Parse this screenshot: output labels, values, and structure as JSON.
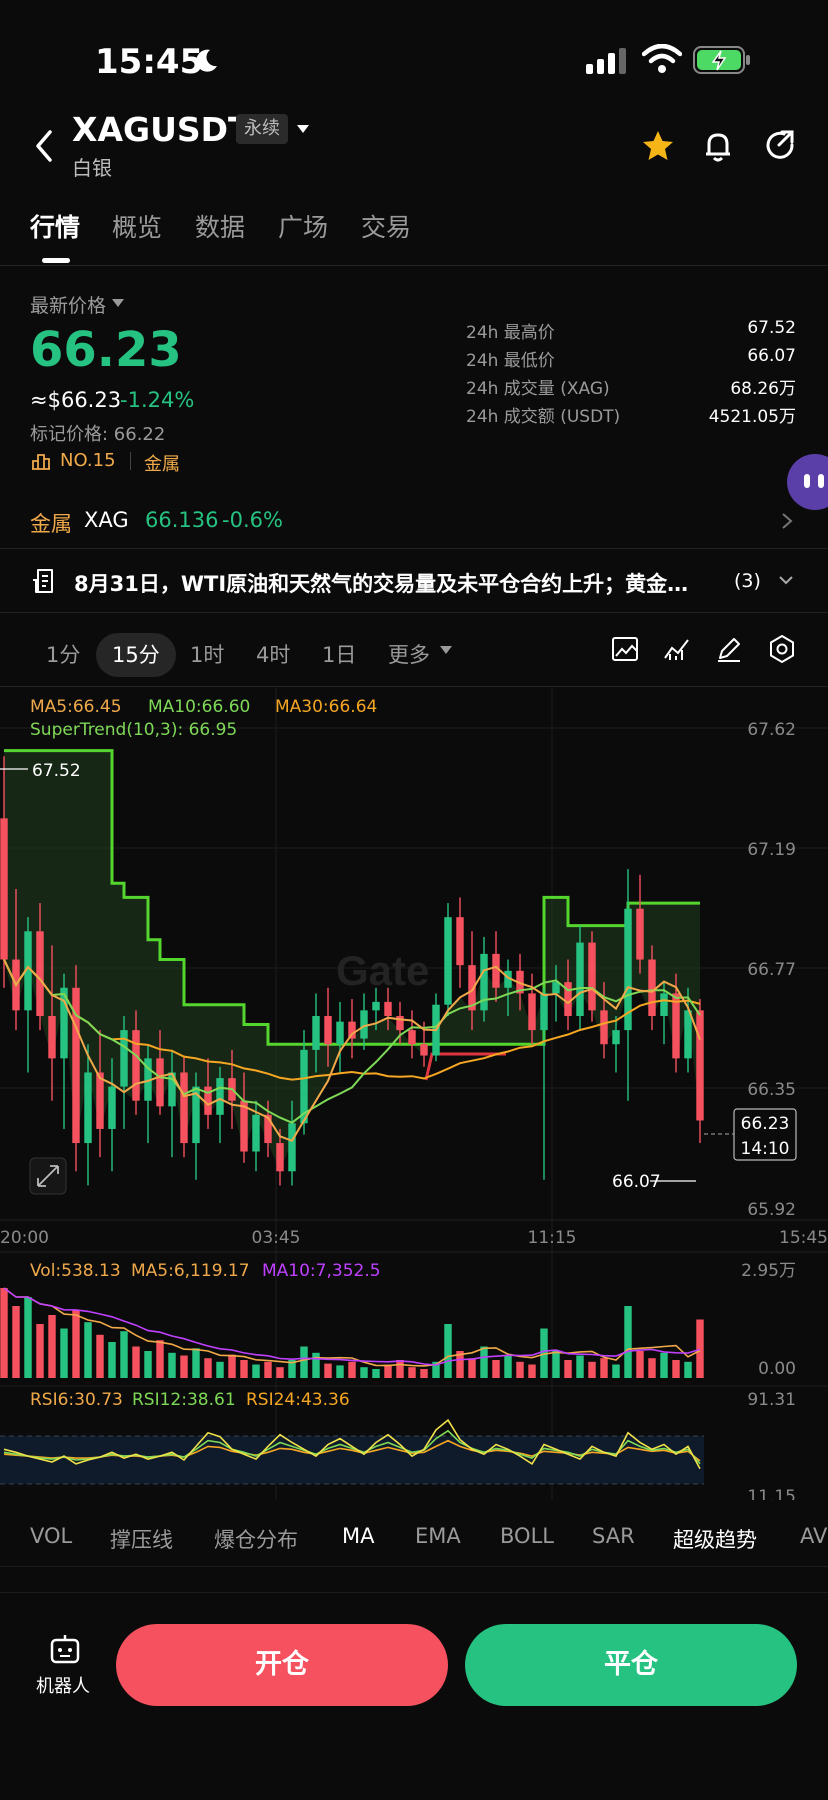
{
  "status_bar": {
    "time": "15:45"
  },
  "header": {
    "pair": "XAGUSDT",
    "contract_type": "永续",
    "subtitle": "白银"
  },
  "tabs": [
    {
      "label": "行情",
      "active": true
    },
    {
      "label": "概览"
    },
    {
      "label": "数据"
    },
    {
      "label": "广场"
    },
    {
      "label": "交易"
    }
  ],
  "price": {
    "label": "最新价格",
    "last": "66.23",
    "usd": "≈$66.23",
    "change": "-1.24%",
    "mark": "标记价格: 66.22",
    "rank": "NO.15",
    "category": "金属"
  },
  "stats": [
    {
      "label": "24h 最高价",
      "value": "67.52"
    },
    {
      "label": "24h 最低价",
      "value": "66.07"
    },
    {
      "label": "24h 成交量 (XAG)",
      "value": "68.26万"
    },
    {
      "label": "24h 成交额 (USDT)",
      "value": "4521.05万"
    }
  ],
  "metal": {
    "label": "金属",
    "code": "XAG",
    "price": "66.136",
    "change": "-0.6%"
  },
  "news": {
    "text": "8月31日，WTI原油和天然气的交易量及未平仓合约上升；黄金…",
    "count": "(3)"
  },
  "intervals": [
    {
      "label": "1分"
    },
    {
      "label": "15分",
      "active": true
    },
    {
      "label": "1时"
    },
    {
      "label": "4时"
    },
    {
      "label": "1日"
    },
    {
      "label": "更多"
    }
  ],
  "chart_legend": {
    "ma5": "MA5:66.45",
    "ma10": "MA10:66.60",
    "ma30": "MA30:66.64",
    "supertrend": "SuperTrend(10,3): 66.95",
    "high_marker": "67.52",
    "low_marker": "66.07",
    "current_price": "66.23",
    "countdown": "14:10"
  },
  "vol_legend": {
    "vol": "Vol:538.13",
    "ma5": "MA5:6,119.17",
    "ma10": "MA10:7,352.5"
  },
  "rsi_legend": {
    "rsi6": "RSI6:30.73",
    "rsi12": "RSI12:38.61",
    "rsi24": "RSI24:43.36"
  },
  "indicators": [
    "VOL",
    "撑压线",
    "爆仓分布",
    "MA",
    "EMA",
    "BOLL",
    "SAR",
    "超级趋势",
    "AV"
  ],
  "actions": {
    "robot": "机器人",
    "open": "开仓",
    "close": "平仓"
  },
  "colors": {
    "up": "#26c281",
    "down": "#f5515f",
    "ma5": "#f0a94a",
    "ma10": "#7ed957",
    "ma30": "#f5a623",
    "vol_ma10": "#c040ff"
  },
  "chart_data": {
    "type": "candlestick",
    "price_axis": [
      "67.62",
      "67.19",
      "66.77",
      "66.35",
      "65.92"
    ],
    "time_axis": [
      "20:00",
      "03:45",
      "11:15",
      "15:45"
    ],
    "vol_axis": [
      "2.95万",
      "0.00"
    ],
    "rsi_axis": [
      "91.31",
      "11.15"
    ],
    "ylim": [
      65.92,
      67.62
    ],
    "candles": [
      [
        67.3,
        67.52,
        66.7,
        66.8
      ],
      [
        66.8,
        67.05,
        66.55,
        66.62
      ],
      [
        66.62,
        66.95,
        66.4,
        66.9
      ],
      [
        66.9,
        67.0,
        66.55,
        66.6
      ],
      [
        66.6,
        66.85,
        66.3,
        66.45
      ],
      [
        66.45,
        66.75,
        66.2,
        66.7
      ],
      [
        66.7,
        66.78,
        66.05,
        66.15
      ],
      [
        66.15,
        66.5,
        66.0,
        66.4
      ],
      [
        66.4,
        66.55,
        66.1,
        66.2
      ],
      [
        66.2,
        66.45,
        66.05,
        66.35
      ],
      [
        66.35,
        66.6,
        66.2,
        66.55
      ],
      [
        66.55,
        66.62,
        66.25,
        66.3
      ],
      [
        66.3,
        66.5,
        66.15,
        66.45
      ],
      [
        66.45,
        66.55,
        66.25,
        66.28
      ],
      [
        66.28,
        66.48,
        66.1,
        66.4
      ],
      [
        66.4,
        66.46,
        66.1,
        66.15
      ],
      [
        66.15,
        66.4,
        66.02,
        66.35
      ],
      [
        66.35,
        66.45,
        66.2,
        66.25
      ],
      [
        66.25,
        66.42,
        66.15,
        66.38
      ],
      [
        66.38,
        66.48,
        66.2,
        66.3
      ],
      [
        66.3,
        66.4,
        66.08,
        66.12
      ],
      [
        66.12,
        66.3,
        66.05,
        66.25
      ],
      [
        66.25,
        66.3,
        66.1,
        66.15
      ],
      [
        66.15,
        66.2,
        66.0,
        66.05
      ],
      [
        66.05,
        66.3,
        66.0,
        66.22
      ],
      [
        66.22,
        66.55,
        66.18,
        66.48
      ],
      [
        66.48,
        66.68,
        66.4,
        66.6
      ],
      [
        66.6,
        66.7,
        66.42,
        66.5
      ],
      [
        66.5,
        66.65,
        66.4,
        66.58
      ],
      [
        66.58,
        66.66,
        66.45,
        66.52
      ],
      [
        66.52,
        66.68,
        66.48,
        66.62
      ],
      [
        66.62,
        66.7,
        66.55,
        66.65
      ],
      [
        66.65,
        66.7,
        66.55,
        66.6
      ],
      [
        66.6,
        66.65,
        66.5,
        66.55
      ],
      [
        66.55,
        66.62,
        66.45,
        66.5
      ],
      [
        66.5,
        66.58,
        66.42,
        66.46
      ],
      [
        66.46,
        66.68,
        66.44,
        66.64
      ],
      [
        66.64,
        67.0,
        66.6,
        66.95
      ],
      [
        66.95,
        67.02,
        66.7,
        66.78
      ],
      [
        66.78,
        66.9,
        66.55,
        66.62
      ],
      [
        66.62,
        66.88,
        66.58,
        66.82
      ],
      [
        66.82,
        66.9,
        66.65,
        66.7
      ],
      [
        66.7,
        66.8,
        66.6,
        66.76
      ],
      [
        66.76,
        66.82,
        66.62,
        66.68
      ],
      [
        66.68,
        66.75,
        66.5,
        66.55
      ],
      [
        66.55,
        66.7,
        66.02,
        66.68
      ],
      [
        66.68,
        66.78,
        66.58,
        66.72
      ],
      [
        66.72,
        66.8,
        66.55,
        66.6
      ],
      [
        66.6,
        66.92,
        66.55,
        66.86
      ],
      [
        66.86,
        66.9,
        66.58,
        66.62
      ],
      [
        66.62,
        66.72,
        66.45,
        66.5
      ],
      [
        66.5,
        66.6,
        66.4,
        66.55
      ],
      [
        66.55,
        67.12,
        66.3,
        66.98
      ],
      [
        66.98,
        67.1,
        66.75,
        66.8
      ],
      [
        66.8,
        66.85,
        66.55,
        66.6
      ],
      [
        66.6,
        66.72,
        66.5,
        66.68
      ],
      [
        66.68,
        66.75,
        66.4,
        66.45
      ],
      [
        66.45,
        66.7,
        66.4,
        66.62
      ],
      [
        66.62,
        66.66,
        66.15,
        66.23
      ]
    ],
    "volumes": [
      1.0,
      0.8,
      0.9,
      0.6,
      0.7,
      0.55,
      0.75,
      0.62,
      0.48,
      0.4,
      0.52,
      0.35,
      0.3,
      0.42,
      0.28,
      0.25,
      0.33,
      0.22,
      0.18,
      0.26,
      0.2,
      0.15,
      0.18,
      0.12,
      0.2,
      0.35,
      0.28,
      0.16,
      0.14,
      0.18,
      0.12,
      0.1,
      0.15,
      0.2,
      0.12,
      0.1,
      0.18,
      0.6,
      0.3,
      0.22,
      0.35,
      0.2,
      0.25,
      0.18,
      0.15,
      0.55,
      0.3,
      0.2,
      0.25,
      0.18,
      0.22,
      0.15,
      0.8,
      0.3,
      0.22,
      0.28,
      0.2,
      0.18,
      0.65
    ],
    "rsi6": [
      55,
      52,
      48,
      45,
      42,
      48,
      40,
      44,
      47,
      52,
      46,
      50,
      45,
      48,
      52,
      44,
      58,
      72,
      68,
      55,
      50,
      45,
      58,
      70,
      62,
      55,
      48,
      60,
      66,
      58,
      50,
      62,
      70,
      60,
      48,
      55,
      75,
      85,
      65,
      55,
      50,
      60,
      55,
      48,
      40,
      60,
      55,
      50,
      45,
      58,
      52,
      48,
      72,
      62,
      55,
      60,
      50,
      58,
      35
    ],
    "rsi12": [
      52,
      50,
      48,
      46,
      45,
      47,
      44,
      45,
      47,
      50,
      48,
      49,
      47,
      48,
      50,
      47,
      55,
      64,
      62,
      55,
      52,
      48,
      55,
      62,
      58,
      54,
      50,
      56,
      60,
      56,
      52,
      58,
      62,
      57,
      52,
      54,
      66,
      74,
      62,
      56,
      52,
      56,
      54,
      50,
      46,
      56,
      54,
      52,
      48,
      55,
      52,
      50,
      64,
      58,
      54,
      56,
      52,
      55,
      40
    ],
    "rsi24": [
      50,
      49,
      48,
      47,
      46,
      47,
      46,
      46,
      47,
      49,
      48,
      48,
      47,
      48,
      49,
      47,
      52,
      58,
      57,
      53,
      51,
      49,
      52,
      56,
      55,
      52,
      50,
      53,
      56,
      54,
      51,
      54,
      57,
      54,
      51,
      52,
      58,
      64,
      58,
      54,
      52,
      54,
      53,
      51,
      48,
      53,
      52,
      51,
      49,
      52,
      51,
      50,
      57,
      55,
      53,
      54,
      51,
      53,
      43
    ]
  }
}
